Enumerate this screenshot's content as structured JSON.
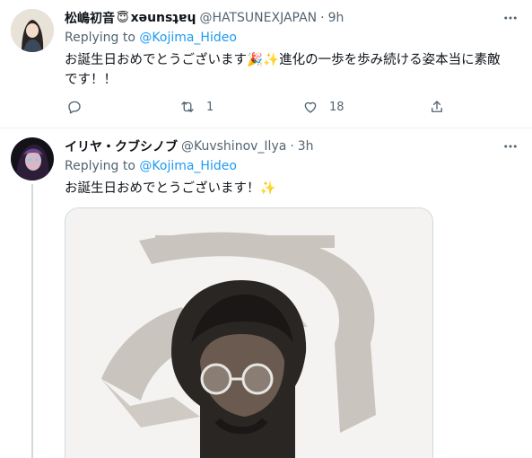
{
  "tweets": [
    {
      "name": "松嶋初音",
      "name_suffix": "xəunsʇɐɥ",
      "badge_emoji": "😇",
      "handle": "@HATSUNEXJAPAN",
      "separator": "·",
      "time": "9h",
      "replying_prefix": "Replying to",
      "replying_mention": "@Kojima_Hideo",
      "text_line1": "お誕生日おめでとうございます🎉✨進化の一歩を歩み続ける姿本当に素敵",
      "text_line2": "です！！",
      "reply_count": "",
      "retweet_count": "1",
      "like_count": "18"
    },
    {
      "name": "イリヤ・クブシノブ",
      "handle": "@Kuvshinov_Ilya",
      "separator": "·",
      "time": "3h",
      "replying_prefix": "Replying to",
      "replying_mention": "@Kojima_Hideo",
      "text_line1": "お誕生日おめでとうございます！✨"
    }
  ],
  "icons": {
    "reply": "reply-icon",
    "retweet": "retweet-icon",
    "like": "like-icon",
    "share": "share-icon",
    "more": "more-icon"
  },
  "colors": {
    "link": "#1d9bf0",
    "secondary_text": "#536471",
    "border": "#cfd9de"
  }
}
